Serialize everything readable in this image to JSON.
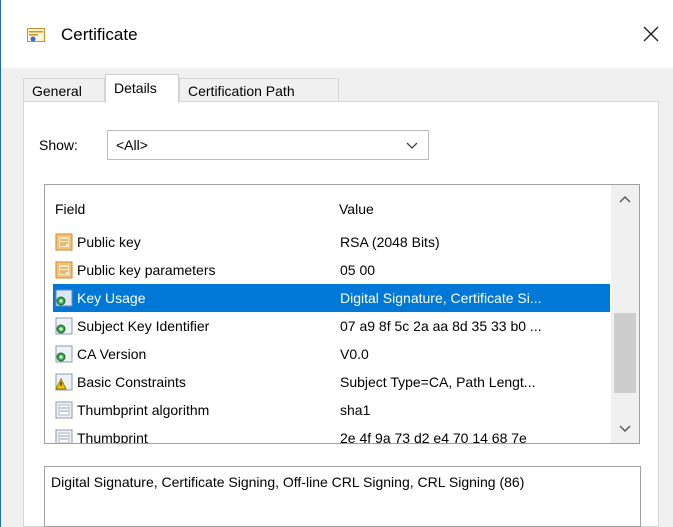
{
  "window": {
    "title": "Certificate"
  },
  "tabs": [
    {
      "label": "General",
      "active": false
    },
    {
      "label": "Details",
      "active": true
    },
    {
      "label": "Certification Path",
      "active": false
    }
  ],
  "show": {
    "label": "Show:",
    "value": "<All>"
  },
  "list": {
    "headers": {
      "field": "Field",
      "value": "Value"
    },
    "rows": [
      {
        "field": "Public key",
        "value": "RSA (2048 Bits)",
        "icon": "certificate-field-icon",
        "selected": false
      },
      {
        "field": "Public key parameters",
        "value": "05 00",
        "icon": "certificate-field-icon",
        "selected": false
      },
      {
        "field": "Key Usage",
        "value": "Digital Signature, Certificate Si...",
        "icon": "extension-icon",
        "selected": true
      },
      {
        "field": "Subject Key Identifier",
        "value": "07 a9 8f 5c 2a aa 8d 35 33 b0 ...",
        "icon": "extension-icon",
        "selected": false
      },
      {
        "field": "CA Version",
        "value": "V0.0",
        "icon": "extension-icon",
        "selected": false
      },
      {
        "field": "Basic Constraints",
        "value": "Subject Type=CA, Path Lengt...",
        "icon": "critical-extension-icon",
        "selected": false
      },
      {
        "field": "Thumbprint algorithm",
        "value": "sha1",
        "icon": "property-icon",
        "selected": false
      },
      {
        "field": "Thumbprint",
        "value": "2e 4f 9a 73 d2 e4 70 14 68 7e",
        "icon": "property-icon",
        "selected": false
      }
    ]
  },
  "detail": {
    "text": "Digital Signature, Certificate Signing, Off-line CRL Signing, CRL Signing (86)"
  },
  "colors": {
    "selection": "#0078d7",
    "accent": "#1f6fb5"
  }
}
